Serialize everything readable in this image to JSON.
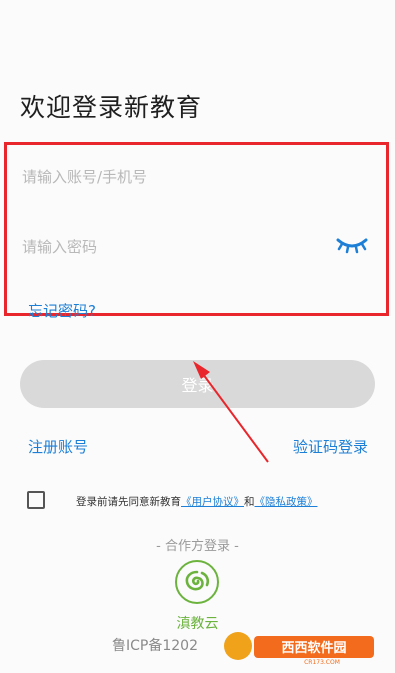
{
  "page": {
    "title": "欢迎登录新教育"
  },
  "form": {
    "account_placeholder": "请输入账号/手机号",
    "password_placeholder": "请输入密码",
    "forgot_label": "忘记密码?"
  },
  "actions": {
    "login_label": "登录",
    "register_label": "注册账号",
    "code_login_label": "验证码登录"
  },
  "agreement": {
    "checked": false,
    "prefix": "登录前请先同意新教育",
    "user_agreement": "《用户协议》",
    "and": "和",
    "privacy_policy": "《隐私政策》"
  },
  "partner": {
    "title": "- 合作方登录 -",
    "name": "滇教云"
  },
  "footer": {
    "icp": "鲁ICP备1202"
  },
  "watermark": {
    "text": "西西软件园",
    "sub": "CR173.COM"
  },
  "colors": {
    "accent": "#1d7fd6",
    "highlight_border": "#e8262b",
    "partner_green": "#6cb33e",
    "button_disabled": "#d9d9d9"
  }
}
